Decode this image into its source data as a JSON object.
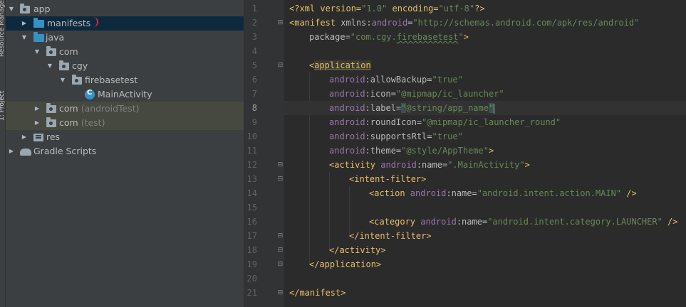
{
  "toolstrip": {
    "top_tab": "Resource Manager",
    "project_tab": "1: Project"
  },
  "tree": {
    "items": [
      {
        "label": "app",
        "suffix": ""
      },
      {
        "label": "manifests",
        "suffix": ""
      },
      {
        "label": "java",
        "suffix": ""
      },
      {
        "label": "com",
        "suffix": ""
      },
      {
        "label": "cgy",
        "suffix": ""
      },
      {
        "label": "firebasetest",
        "suffix": ""
      },
      {
        "label": "MainActivity",
        "suffix": ""
      },
      {
        "label": "com",
        "suffix": "(androidTest)"
      },
      {
        "label": "com",
        "suffix": "(test)"
      },
      {
        "label": "res",
        "suffix": ""
      },
      {
        "label": "Gradle Scripts",
        "suffix": ""
      }
    ]
  },
  "editor": {
    "line_numbers": [
      "1",
      "2",
      "3",
      "4",
      "5",
      "6",
      "7",
      "8",
      "9",
      "10",
      "11",
      "12",
      "13",
      "14",
      "15",
      "16",
      "17",
      "18",
      "19",
      "20",
      "21"
    ],
    "current_line": "8",
    "lines": {
      "l1": {
        "a": "<?xml version=",
        "b": "\"1.0\"",
        "c": " encoding=",
        "d": "\"utf-8\"",
        "e": "?>"
      },
      "l2": {
        "a": "<manifest",
        "b": " xmlns:",
        "c": "android",
        "d": "=",
        "e": "\"http://schemas.android.com/apk/res/android\""
      },
      "l3": {
        "a": "package=",
        "b": "\"com.cgy.",
        "c": "firebasetest",
        "d": "\"",
        "e": ">"
      },
      "l5": {
        "a": "<",
        "b": "application"
      },
      "l6": {
        "a": "android",
        "b": ":allowBackup=",
        "c": "\"true\""
      },
      "l7": {
        "a": "android",
        "b": ":icon=",
        "c": "\"@mipmap/ic_launcher\""
      },
      "l8": {
        "a": "android",
        "b": ":label=",
        "c": "\"",
        "d": "@string/app_name",
        "e": "\""
      },
      "l9": {
        "a": "android",
        "b": ":roundIcon=",
        "c": "\"@mipmap/ic_launcher_round\""
      },
      "l10": {
        "a": "android",
        "b": ":supportsRtl=",
        "c": "\"true\""
      },
      "l11": {
        "a": "android",
        "b": ":theme=",
        "c": "\"@style/AppTheme\"",
        "d": ">"
      },
      "l12": {
        "a": "<activity ",
        "b": "android",
        "c": ":name=",
        "d": "\".MainActivity\"",
        "e": ">"
      },
      "l13": {
        "a": "<intent-filter>"
      },
      "l14": {
        "a": "<action ",
        "b": "android",
        "c": ":name=",
        "d": "\"android.intent.action.MAIN\"",
        "e": " />"
      },
      "l16": {
        "a": "<category ",
        "b": "android",
        "c": ":name=",
        "d": "\"android.intent.category.LAUNCHER\"",
        "e": " />"
      },
      "l17": {
        "a": "</intent-filter>"
      },
      "l18": {
        "a": "</activity>"
      },
      "l19": {
        "a": "</application>"
      },
      "l21": {
        "a": "</manifest>"
      }
    }
  },
  "colors": {
    "tree_bg": "#3c3f41",
    "selection": "#0d293e",
    "editor_bg": "#2b2b2b",
    "tag": "#e8bf6a",
    "value": "#6a8759",
    "namespace": "#9876aa"
  }
}
